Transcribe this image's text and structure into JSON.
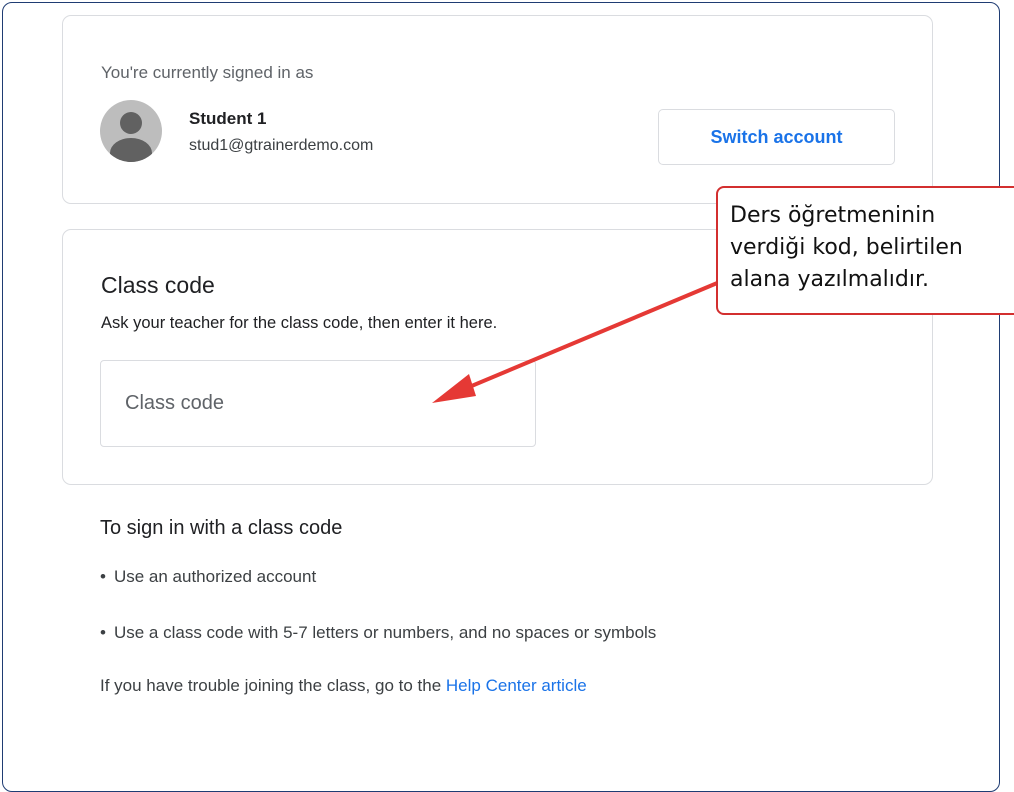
{
  "account": {
    "signed_in_label": "You're currently signed in as",
    "user_name": "Student 1",
    "user_email": "stud1@gtrainerdemo.com",
    "switch_button": "Switch account"
  },
  "class_code": {
    "title": "Class code",
    "description": "Ask your teacher for the class code, then enter it here.",
    "input_placeholder": "Class code",
    "input_value": ""
  },
  "instructions": {
    "title": "To sign in with a class code",
    "bullets": [
      "Use an authorized account",
      "Use a class code with 5-7 letters or numbers, and no spaces or symbols"
    ],
    "help_prefix": "If you have trouble joining the class, go to the",
    "help_link": "Help Center article"
  },
  "annotation": {
    "lines": [
      "Ders öğretmeninin",
      "verdiği kod, belirtilen",
      "alana yazılmalıdır."
    ],
    "color": "#d32f2f"
  },
  "colors": {
    "link": "#1a73e8",
    "border": "#dadce0",
    "frame": "#1f3c73"
  }
}
